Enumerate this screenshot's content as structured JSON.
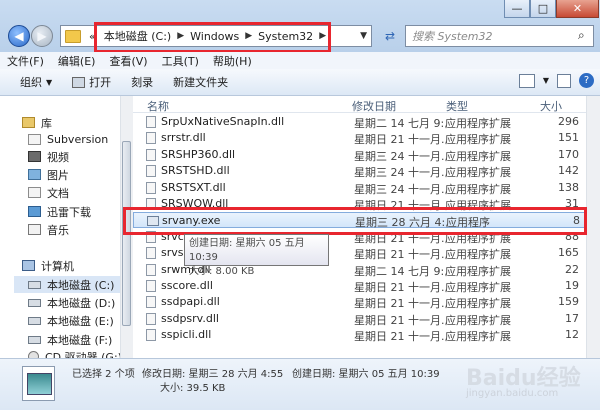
{
  "address": {
    "segments": [
      "本地磁盘 (C:)",
      "Windows",
      "System32"
    ],
    "prefix": "«"
  },
  "search": {
    "placeholder": "搜索 System32"
  },
  "window_controls": {
    "minimize": "—",
    "maximize": "□",
    "close": "✕"
  },
  "menu": [
    "文件(F)",
    "编辑(E)",
    "查看(V)",
    "工具(T)",
    "帮助(H)"
  ],
  "toolbar": {
    "organize": "组织",
    "print": "打开",
    "burn": "刻录",
    "new_folder": "新建文件夹"
  },
  "nav": [
    {
      "label": "库",
      "icon": "library-icon"
    },
    {
      "label": "Subversion",
      "icon": "document-icon"
    },
    {
      "label": "视频",
      "icon": "video-icon"
    },
    {
      "label": "图片",
      "icon": "pictures-icon"
    },
    {
      "label": "文档",
      "icon": "document-icon"
    },
    {
      "label": "迅雷下载",
      "icon": "download-icon"
    },
    {
      "label": "音乐",
      "icon": "music-icon"
    },
    {
      "label": "计算机",
      "icon": "computer-icon"
    },
    {
      "label": "本地磁盘 (C:)",
      "icon": "drive-icon"
    },
    {
      "label": "本地磁盘 (D:)",
      "icon": "drive-icon"
    },
    {
      "label": "本地磁盘 (E:)",
      "icon": "drive-icon"
    },
    {
      "label": "本地磁盘 (F:)",
      "icon": "drive-icon"
    },
    {
      "label": "CD 驱动器 (G:)",
      "icon": "cd-drive-icon"
    }
  ],
  "columns": {
    "name": "名称",
    "date": "修改日期",
    "type": "类型",
    "size": "大小"
  },
  "files": [
    {
      "name": "SrpUxNativeSnapIn.dll",
      "date": "星期二 14 七月 9:...",
      "type": "应用程序扩展",
      "size": "296"
    },
    {
      "name": "srrstr.dll",
      "date": "星期日 21 十一月...",
      "type": "应用程序扩展",
      "size": "151"
    },
    {
      "name": "SRSHP360.dll",
      "date": "星期三 24 十一月...",
      "type": "应用程序扩展",
      "size": "170"
    },
    {
      "name": "SRSTSHD.dll",
      "date": "星期三 24 十一月...",
      "type": "应用程序扩展",
      "size": "142"
    },
    {
      "name": "SRSTSXT.dll",
      "date": "星期三 24 十一月...",
      "type": "应用程序扩展",
      "size": "138"
    },
    {
      "name": "SRSWOW.dll",
      "date": "星期日 21 十一月...",
      "type": "应用程序扩展",
      "size": "31"
    },
    {
      "name": "srvany.exe",
      "date": "星期三 28 六月 4:...",
      "type": "应用程序",
      "size": "8"
    },
    {
      "name": "srvc",
      "date": "星期日 21 十一月...",
      "type": "应用程序扩展",
      "size": "88"
    },
    {
      "name": "srvs",
      "date": "星期日 21 十一月...",
      "type": "应用程序扩展",
      "size": "165"
    },
    {
      "name": "srwmi.dll",
      "date": "星期二 14 七月 9:...",
      "type": "应用程序扩展",
      "size": "22"
    },
    {
      "name": "sscore.dll",
      "date": "星期日 21 十一月...",
      "type": "应用程序扩展",
      "size": "19"
    },
    {
      "name": "ssdpapi.dll",
      "date": "星期日 21 十一月...",
      "type": "应用程序扩展",
      "size": "159"
    },
    {
      "name": "ssdpsrv.dll",
      "date": "星期日 21 十一月...",
      "type": "应用程序扩展",
      "size": "17"
    },
    {
      "name": "sspicli.dll",
      "date": "星期日 21 十一月...",
      "type": "应用程序扩展",
      "size": "12"
    }
  ],
  "tooltip": {
    "created": "创建日期: 星期六 05 五月 10:39",
    "size": "大小: 8.00 KB"
  },
  "status": {
    "selected": "已选择 2 个项",
    "modified": "修改日期: 星期三 28 六月 4:55",
    "created": "创建日期: 星期六 05 五月 10:39",
    "size": "大小: 39.5 KB"
  },
  "watermark": {
    "brand": "Baidu经验",
    "url": "jingyan.baidu.com"
  }
}
